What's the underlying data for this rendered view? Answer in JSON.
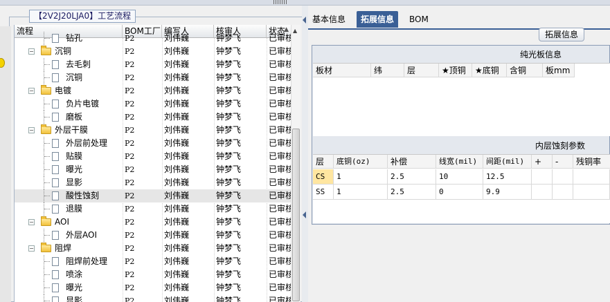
{
  "left": {
    "title": "【2V2J20LJA0】工艺流程",
    "columns": [
      "流程",
      "BOM工厂",
      "编写人",
      "核审人",
      "状态"
    ],
    "rows": [
      {
        "level": 1,
        "type": "doc",
        "name": "钻孔",
        "bom": "P2",
        "writer": "刘伟巍",
        "reviewer": "钟梦飞",
        "status": "已审核"
      },
      {
        "level": 0,
        "type": "folder",
        "name": "沉铜",
        "bom": "P2",
        "writer": "刘伟巍",
        "reviewer": "钟梦飞",
        "status": "已审核"
      },
      {
        "level": 1,
        "type": "doc",
        "name": "去毛刺",
        "bom": "P2",
        "writer": "刘伟巍",
        "reviewer": "钟梦飞",
        "status": "已审核"
      },
      {
        "level": 1,
        "type": "doc",
        "name": "沉铜",
        "bom": "P2",
        "writer": "刘伟巍",
        "reviewer": "钟梦飞",
        "status": "已审核"
      },
      {
        "level": 0,
        "type": "folder",
        "name": "电镀",
        "bom": "P2",
        "writer": "刘伟巍",
        "reviewer": "钟梦飞",
        "status": "已审核"
      },
      {
        "level": 1,
        "type": "doc",
        "name": "负片电镀",
        "bom": "P2",
        "writer": "刘伟巍",
        "reviewer": "钟梦飞",
        "status": "已审核"
      },
      {
        "level": 1,
        "type": "doc",
        "name": "磨板",
        "bom": "P2",
        "writer": "刘伟巍",
        "reviewer": "钟梦飞",
        "status": "已审核"
      },
      {
        "level": 0,
        "type": "folder",
        "name": "外层干膜",
        "bom": "P2",
        "writer": "刘伟巍",
        "reviewer": "钟梦飞",
        "status": "已审核"
      },
      {
        "level": 1,
        "type": "doc",
        "name": "外层前处理",
        "bom": "P2",
        "writer": "刘伟巍",
        "reviewer": "钟梦飞",
        "status": "已审核"
      },
      {
        "level": 1,
        "type": "doc",
        "name": "贴膜",
        "bom": "P2",
        "writer": "刘伟巍",
        "reviewer": "钟梦飞",
        "status": "已审核"
      },
      {
        "level": 1,
        "type": "doc",
        "name": "曝光",
        "bom": "P2",
        "writer": "刘伟巍",
        "reviewer": "钟梦飞",
        "status": "已审核"
      },
      {
        "level": 1,
        "type": "doc",
        "name": "显影",
        "bom": "P2",
        "writer": "刘伟巍",
        "reviewer": "钟梦飞",
        "status": "已审核"
      },
      {
        "level": 1,
        "type": "doc",
        "name": "酸性蚀刻",
        "bom": "P2",
        "writer": "刘伟巍",
        "reviewer": "钟梦飞",
        "status": "已审核",
        "selected": true
      },
      {
        "level": 1,
        "type": "doc",
        "name": "退膜",
        "bom": "P2",
        "writer": "刘伟巍",
        "reviewer": "钟梦飞",
        "status": "已审核"
      },
      {
        "level": 0,
        "type": "folder",
        "name": "AOI",
        "bom": "P2",
        "writer": "刘伟巍",
        "reviewer": "钟梦飞",
        "status": "已审核"
      },
      {
        "level": 1,
        "type": "doc",
        "name": "外层AOI",
        "bom": "P2",
        "writer": "刘伟巍",
        "reviewer": "钟梦飞",
        "status": "已审核"
      },
      {
        "level": 0,
        "type": "folder",
        "name": "阻焊",
        "bom": "P2",
        "writer": "刘伟巍",
        "reviewer": "钟梦飞",
        "status": "已审核"
      },
      {
        "level": 1,
        "type": "doc",
        "name": "阻焊前处理",
        "bom": "P2",
        "writer": "刘伟巍",
        "reviewer": "钟梦飞",
        "status": "已审核"
      },
      {
        "level": 1,
        "type": "doc",
        "name": "喷涂",
        "bom": "P2",
        "writer": "刘伟巍",
        "reviewer": "钟梦飞",
        "status": "已审核"
      },
      {
        "level": 1,
        "type": "doc",
        "name": "曝光",
        "bom": "P2",
        "writer": "刘伟巍",
        "reviewer": "钟梦飞",
        "status": "已审核"
      },
      {
        "level": 1,
        "type": "doc",
        "name": "显影",
        "bom": "P2",
        "writer": "刘伟巍",
        "reviewer": "钟梦飞",
        "status": "已审核"
      }
    ]
  },
  "right": {
    "tabs": [
      {
        "label": "基本信息",
        "active": false
      },
      {
        "label": "拓展信息",
        "active": true
      },
      {
        "label": "BOM",
        "active": false
      }
    ],
    "section_button": "拓展信息",
    "board_group": {
      "title": "纯光板信息",
      "columns": [
        "板材",
        "纬",
        "层",
        "★顶铜",
        "★底铜",
        "含铜",
        "板mm"
      ]
    },
    "etch_group": {
      "title": "内层蚀刻参数",
      "columns": [
        "层",
        "底铜(oz)",
        "补偿",
        "线宽(mil)",
        "间距(mil)",
        "+",
        "-",
        "残铜率"
      ],
      "rows": [
        [
          "CS",
          "1",
          "2.5",
          "10",
          "12.5",
          "",
          "",
          ""
        ],
        [
          "SS",
          "1",
          "2.5",
          "0",
          "9.9",
          "",
          "",
          ""
        ]
      ]
    }
  },
  "colors": {
    "accent": "#3a5f96",
    "selected_row": "#e6e6e6",
    "highlight_cell": "#ffe6a0"
  }
}
